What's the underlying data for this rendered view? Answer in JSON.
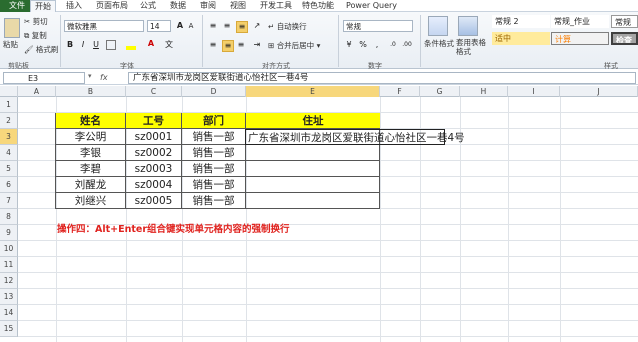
{
  "ribbon": {
    "tabs": [
      "文件",
      "开始",
      "插入",
      "页面布局",
      "公式",
      "数据",
      "审阅",
      "视图",
      "开发工具",
      "特色功能",
      "Power Query"
    ],
    "clipboard": {
      "cut": "剪切",
      "copy": "复制",
      "format_painter": "格式刷",
      "paste": "粘贴",
      "label": "剪贴板"
    },
    "font": {
      "name": "微软雅黑",
      "size": "14",
      "label": "字体",
      "bold": "B",
      "italic": "I",
      "underline": "U"
    },
    "alignment": {
      "wrap": "自动换行",
      "merge": "合并后居中",
      "label": "对齐方式"
    },
    "number": {
      "format": "常规",
      "label": "数字"
    },
    "styles": {
      "conditional": "条件格式",
      "table": "套用表格格式",
      "style_normal2": "常规 2",
      "style_normal_work": "常规_作业",
      "style_normal": "常规",
      "style_medium": "适中",
      "style_calc": "计算",
      "style_check": "检查",
      "label": "样式"
    }
  },
  "formula_bar": {
    "name_box": "E3",
    "fx": "fx",
    "content": "广东省深圳市龙岗区爱联街道心怡社区一巷4号"
  },
  "columns": [
    "A",
    "B",
    "C",
    "D",
    "E",
    "F",
    "G",
    "H",
    "I",
    "J"
  ],
  "rows": [
    "1",
    "2",
    "3",
    "4",
    "5",
    "6",
    "7",
    "8",
    "9",
    "10",
    "11",
    "12",
    "13",
    "14",
    "15"
  ],
  "table": {
    "headers": [
      "姓名",
      "工号",
      "部门",
      "住址"
    ],
    "rows": [
      [
        "李公明",
        "sz0001",
        "销售一部",
        "广东省深圳市龙岗区爱联街道心怡社区一巷4号"
      ],
      [
        "李银",
        "sz0002",
        "销售一部",
        ""
      ],
      [
        "李碧",
        "sz0003",
        "销售一部",
        ""
      ],
      [
        "刘醒龙",
        "sz0004",
        "销售一部",
        ""
      ],
      [
        "刘继兴",
        "sz0005",
        "销售一部",
        ""
      ]
    ]
  },
  "note": "操作四：Alt+Enter组合键实现单元格内容的强制换行"
}
